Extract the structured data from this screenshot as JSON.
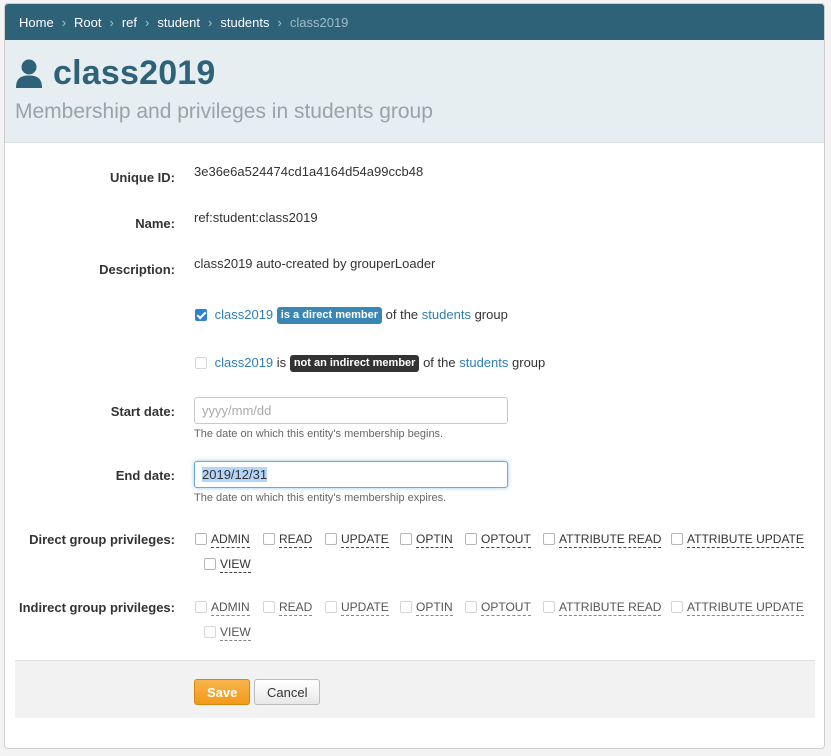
{
  "breadcrumb": {
    "items": [
      "Home",
      "Root",
      "ref",
      "student",
      "students"
    ],
    "current": "class2019",
    "separator": "›"
  },
  "header": {
    "title": "class2019",
    "subtitle": "Membership and privileges in students group",
    "icon": "user-icon"
  },
  "fields": {
    "unique_id_label": "Unique ID:",
    "unique_id": "3e36e6a524474cd1a4164d54a99ccb48",
    "name_label": "Name:",
    "name": "ref:student:class2019",
    "description_label": "Description:",
    "description": "class2019 auto-created by grouperLoader"
  },
  "membership": {
    "direct": {
      "checked": true,
      "entity": "class2019",
      "badge": "is a direct member",
      "of_the": "of the",
      "group": "students",
      "suffix": "group"
    },
    "indirect": {
      "checked": false,
      "entity": "class2019",
      "is": "is",
      "badge": "not an indirect member",
      "of_the": "of the",
      "group": "students",
      "suffix": "group"
    }
  },
  "dates": {
    "start_label": "Start date:",
    "start_placeholder": "yyyy/mm/dd",
    "start_value": "",
    "start_help": "The date on which this entity's membership begins.",
    "end_label": "End date:",
    "end_value": "2019/12/31",
    "end_help": "The date on which this entity's membership expires."
  },
  "privileges": {
    "direct_label": "Direct group privileges:",
    "indirect_label": "Indirect group privileges:",
    "items": [
      "ADMIN",
      "READ",
      "UPDATE",
      "OPTIN",
      "OPTOUT",
      "ATTRIBUTE READ",
      "ATTRIBUTE UPDATE",
      "VIEW"
    ]
  },
  "actions": {
    "save": "Save",
    "cancel": "Cancel"
  },
  "colors": {
    "accent": "#2e6279",
    "link": "#2e7fb2",
    "save_button": "#f09a1a",
    "direct_badge": "#3a86b5",
    "indirect_badge": "#333333"
  }
}
